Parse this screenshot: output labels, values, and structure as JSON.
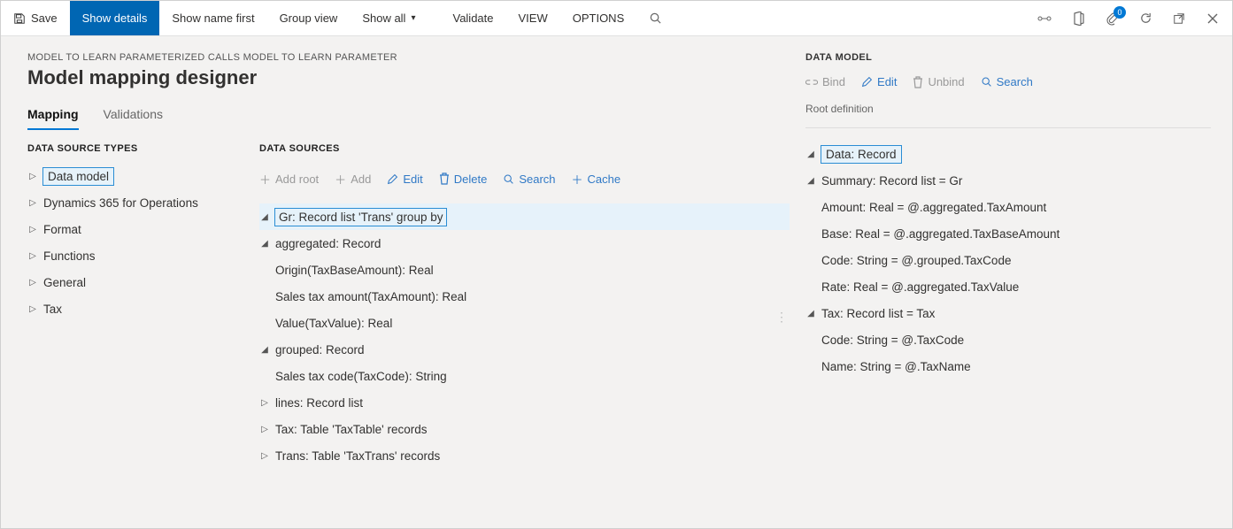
{
  "commandBar": {
    "save": "Save",
    "showDetails": "Show details",
    "showNameFirst": "Show name first",
    "groupView": "Group view",
    "showAll": "Show all",
    "validate": "Validate",
    "view": "VIEW",
    "options": "OPTIONS",
    "badgeCount": "0"
  },
  "breadcrumb": "MODEL TO LEARN PARAMETERIZED CALLS MODEL TO LEARN PARAMETER",
  "pageTitle": "Model mapping designer",
  "tabs": {
    "mapping": "Mapping",
    "validations": "Validations"
  },
  "colHeaders": {
    "types": "DATA SOURCE TYPES",
    "sources": "DATA SOURCES",
    "model": "DATA MODEL"
  },
  "dataSourceTypes": [
    "Data model",
    "Dynamics 365 for Operations",
    "Format",
    "Functions",
    "General",
    "Tax"
  ],
  "dsToolbar": {
    "addRoot": "Add root",
    "add": "Add",
    "edit": "Edit",
    "delete": "Delete",
    "search": "Search",
    "cache": "Cache"
  },
  "dsTree": {
    "gr": "Gr: Record list 'Trans' group by",
    "aggregated": "aggregated: Record",
    "originTaxBase": "Origin(TaxBaseAmount): Real",
    "salesTaxAmount": "Sales tax amount(TaxAmount): Real",
    "valueTaxValue": "Value(TaxValue): Real",
    "grouped": "grouped: Record",
    "salesTaxCode": "Sales tax code(TaxCode): String",
    "lines": "lines: Record list",
    "taxTable": "Tax: Table 'TaxTable' records",
    "transTable": "Trans: Table 'TaxTrans' records"
  },
  "dmToolbar": {
    "bind": "Bind",
    "edit": "Edit",
    "unbind": "Unbind",
    "search": "Search",
    "rootDef": "Root definition"
  },
  "dmTree": {
    "data": "Data: Record",
    "summary": "Summary: Record list = Gr",
    "amount": "Amount: Real = @.aggregated.TaxAmount",
    "base": "Base: Real = @.aggregated.TaxBaseAmount",
    "code1": "Code: String = @.grouped.TaxCode",
    "rate": "Rate: Real = @.aggregated.TaxValue",
    "tax": "Tax: Record list = Tax",
    "code2": "Code: String = @.TaxCode",
    "name": "Name: String = @.TaxName"
  }
}
